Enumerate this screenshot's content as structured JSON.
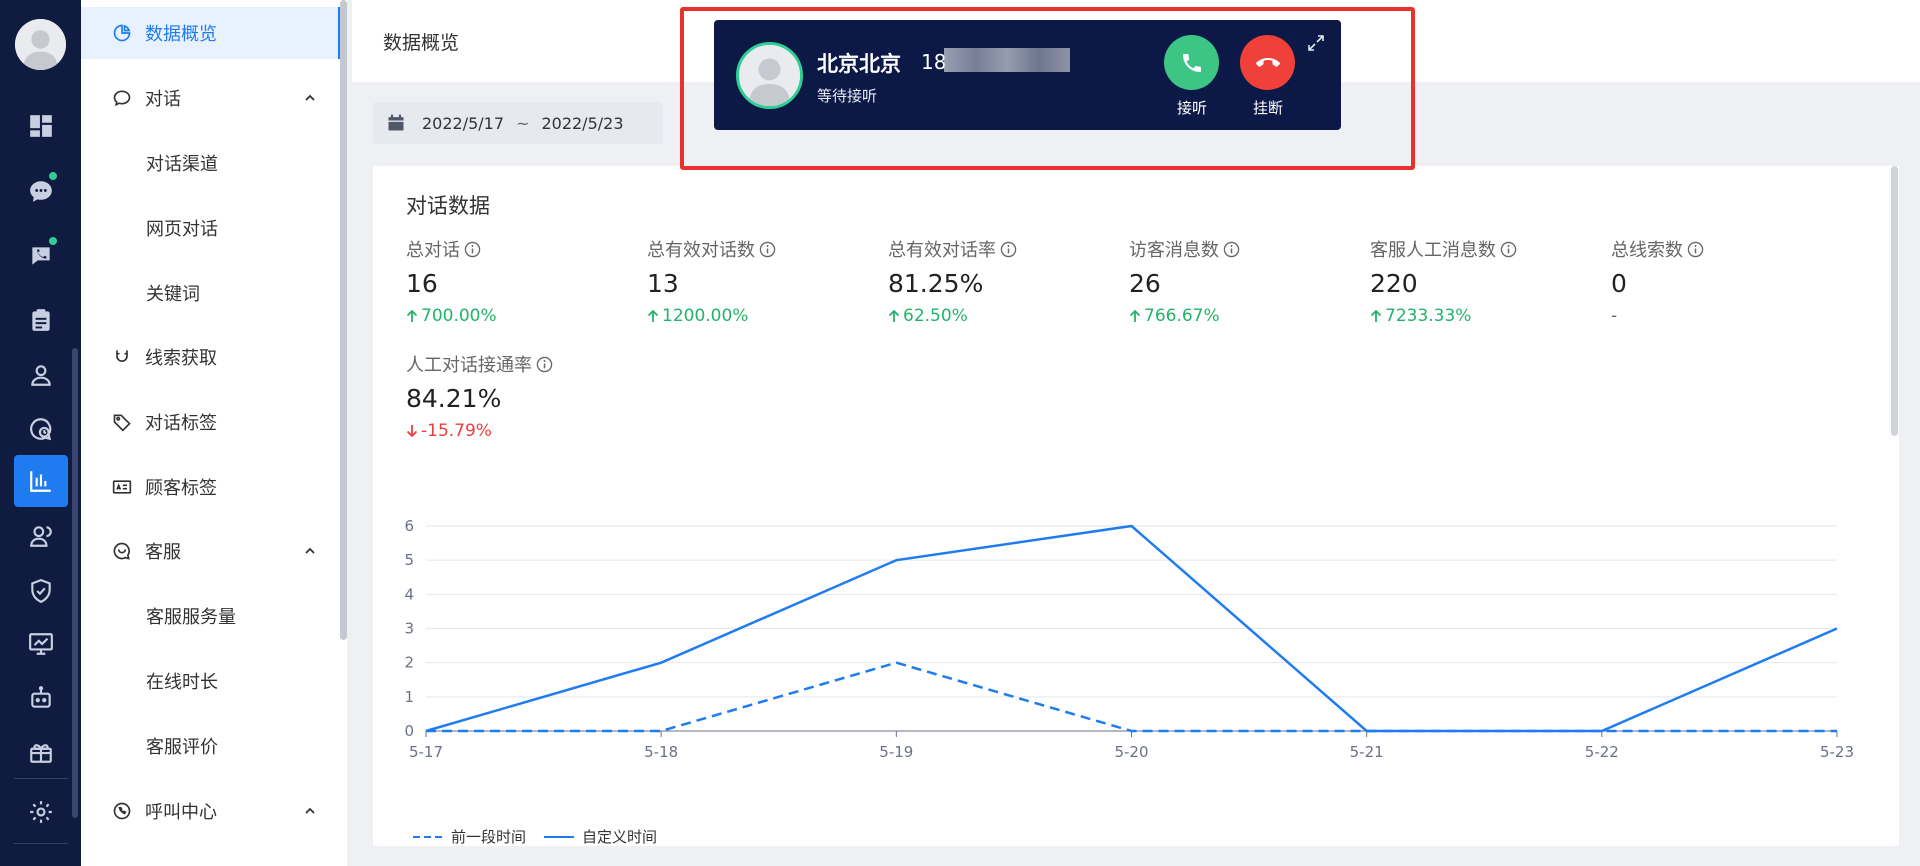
{
  "header": {
    "title": "数据概览"
  },
  "submenu": {
    "items": [
      {
        "label": "数据概览",
        "icon": "pie-chart-icon",
        "active": true
      },
      {
        "label": "对话",
        "icon": "chat-bubble-icon",
        "expanded": true
      },
      {
        "label": "对话渠道",
        "child": true
      },
      {
        "label": "网页对话",
        "child": true
      },
      {
        "label": "关键词",
        "child": true
      },
      {
        "label": "线索获取",
        "icon": "magnet-icon"
      },
      {
        "label": "对话标签",
        "icon": "tag-icon"
      },
      {
        "label": "顾客标签",
        "icon": "id-card-icon"
      },
      {
        "label": "客服",
        "icon": "headset-chat-icon",
        "expanded": true
      },
      {
        "label": "客服服务量",
        "child": true
      },
      {
        "label": "在线时长",
        "child": true
      },
      {
        "label": "客服评价",
        "child": true
      },
      {
        "label": "呼叫中心",
        "icon": "phone-circle-icon",
        "expanded": true
      }
    ]
  },
  "date_range": {
    "start": "2022/5/17",
    "separator": "~",
    "end": "2022/5/23"
  },
  "card": {
    "title": "对话数据",
    "stats": [
      {
        "label": "总对话",
        "value": "16",
        "change": "700.00%",
        "direction": "up"
      },
      {
        "label": "总有效对话数",
        "value": "13",
        "change": "1200.00%",
        "direction": "up"
      },
      {
        "label": "总有效对话率",
        "value": "81.25%",
        "change": "62.50%",
        "direction": "up"
      },
      {
        "label": "访客消息数",
        "value": "26",
        "change": "766.67%",
        "direction": "up"
      },
      {
        "label": "客服人工消息数",
        "value": "220",
        "change": "7233.33%",
        "direction": "up"
      },
      {
        "label": "总线索数",
        "value": "0",
        "change": "-",
        "direction": "flat"
      },
      {
        "label": "人工对话接通率",
        "value": "84.21%",
        "change": "-15.79%",
        "direction": "down"
      }
    ]
  },
  "chart_data": {
    "type": "line",
    "title": "",
    "xlabel": "",
    "ylabel": "",
    "x": [
      "5-17",
      "5-18",
      "5-19",
      "5-20",
      "5-21",
      "5-22",
      "5-23"
    ],
    "ylim": [
      0,
      6
    ],
    "yticks": [
      0,
      1,
      2,
      3,
      4,
      5,
      6
    ],
    "grid": true,
    "legend_position": "bottom-left",
    "series": [
      {
        "name": "前一段时间",
        "values": [
          0,
          0,
          2,
          0,
          0,
          0,
          0
        ],
        "style": "dashed",
        "color": "#1f7cf0"
      },
      {
        "name": "自定义时间",
        "values": [
          0,
          2,
          5,
          6,
          0,
          0,
          3
        ],
        "style": "solid",
        "color": "#1f7cf0"
      }
    ]
  },
  "call": {
    "location": "北京北京",
    "number_prefix": "18",
    "status": "等待接听",
    "answer_label": "接听",
    "hangup_label": "挂断",
    "answer_color": "#3cc585",
    "hangup_color": "#f0403a"
  },
  "colors": {
    "accent": "#1f7cf0",
    "rail_bg": "#0f1b3f",
    "up": "#22b46a",
    "down": "#f03c3c"
  }
}
